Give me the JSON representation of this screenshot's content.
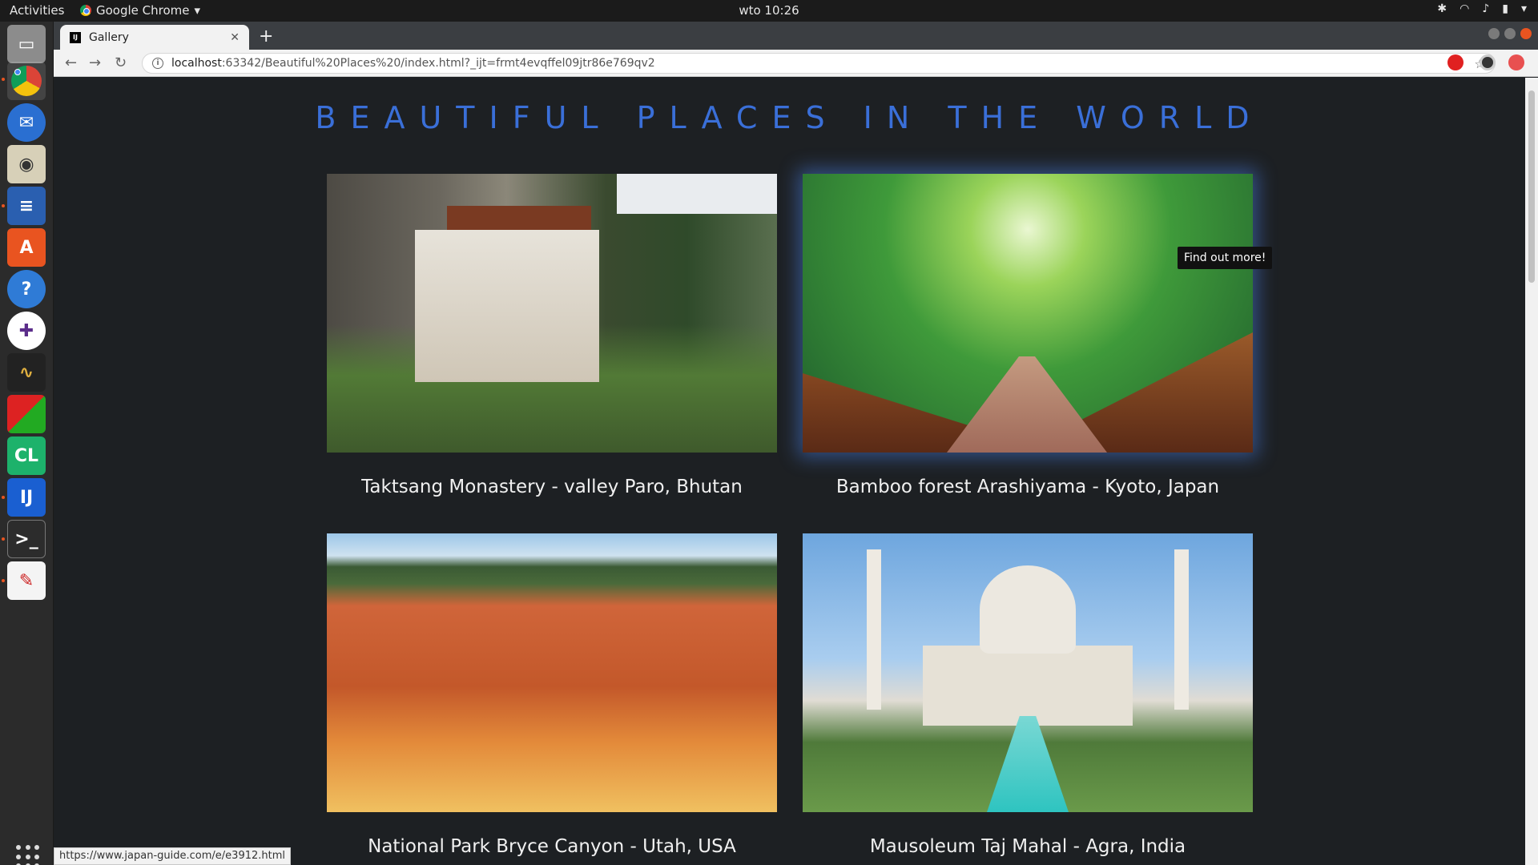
{
  "system": {
    "activities": "Activities",
    "app_name": "Google Chrome",
    "clock": "wto 10:26"
  },
  "browser": {
    "tab_title": "Gallery",
    "favicon_text": "IJ",
    "url_host": "localhost",
    "url_path": ":63342/Beautiful%20Places%20/index.html?_ijt=frmt4evqffel09jtr86e769qv2",
    "status_url": "https://www.japan-guide.com/e/e3912.html"
  },
  "page": {
    "title": "BEAUTIFUL PLACES IN THE WORLD",
    "tooltip": "Find out more!",
    "cards": [
      {
        "caption": "Taktsang Monastery - valley Paro, Bhutan"
      },
      {
        "caption": "Bamboo forest Arashiyama - Kyoto, Japan"
      },
      {
        "caption": "National Park Bryce Canyon - Utah, USA"
      },
      {
        "caption": "Mausoleum Taj Mahal - Agra, India"
      }
    ]
  },
  "colors": {
    "title": "#3a6fd8",
    "background": "#1d2023",
    "accent": "#e95420"
  },
  "icons": [
    "chrome-icon",
    "files-icon",
    "thunderbird-icon",
    "rhythmbox-icon",
    "writer-icon",
    "software-icon",
    "help-icon",
    "slack-icon",
    "monitor-icon",
    "multicolor-icon",
    "clion-icon",
    "intellij-icon",
    "terminal-icon",
    "editor-icon",
    "apps-grid-icon"
  ]
}
